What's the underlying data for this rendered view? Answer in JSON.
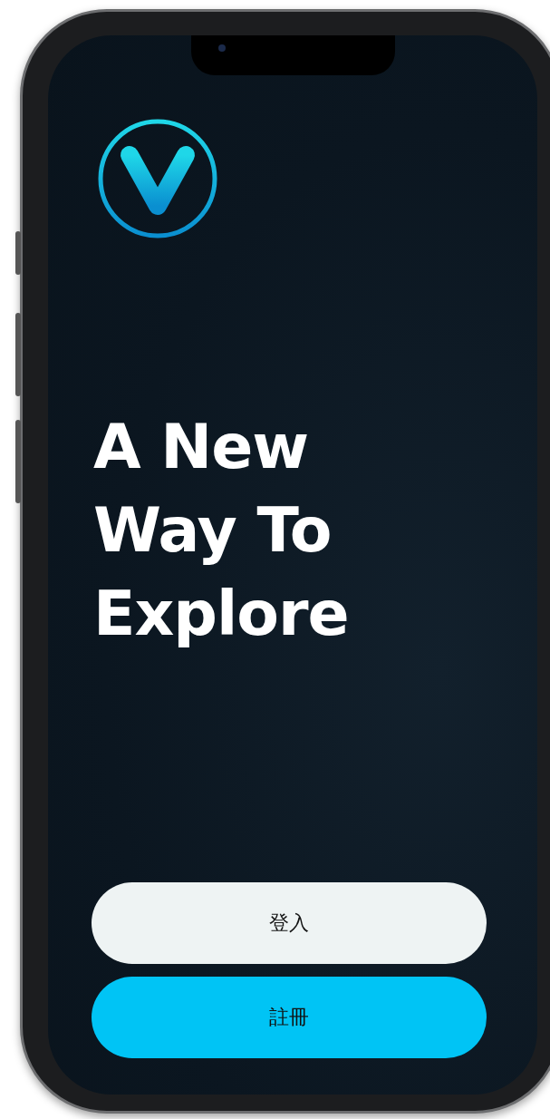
{
  "screen": {
    "headline_lines": [
      "A New",
      "Way To",
      "Explore"
    ],
    "buttons": [
      {
        "label": "登入",
        "kind": "secondary"
      },
      {
        "label": "註冊",
        "kind": "primary"
      }
    ]
  }
}
